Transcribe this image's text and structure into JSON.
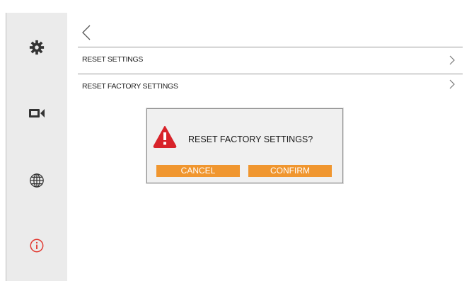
{
  "sidebar": {
    "items": [
      {
        "icon": "gear-icon"
      },
      {
        "icon": "video-camera-icon"
      },
      {
        "icon": "globe-icon"
      },
      {
        "icon": "info-icon",
        "color": "#e2372f"
      }
    ]
  },
  "header": {
    "back_icon": "chevron-left-icon"
  },
  "menu": {
    "rows": [
      {
        "label": "RESET SETTINGS",
        "icon": "chevron-right-icon"
      },
      {
        "label": "RESET FACTORY SETTINGS",
        "icon": "chevron-right-icon"
      }
    ]
  },
  "dialog": {
    "icon": "warning-icon",
    "message": "RESET FACTORY SETTINGS?",
    "cancel_label": "CANCEL",
    "confirm_label": "CONFIRM"
  },
  "colors": {
    "accent": "#f0962f",
    "warning": "#d8232a",
    "sidebar_bg": "#ebebeb"
  }
}
